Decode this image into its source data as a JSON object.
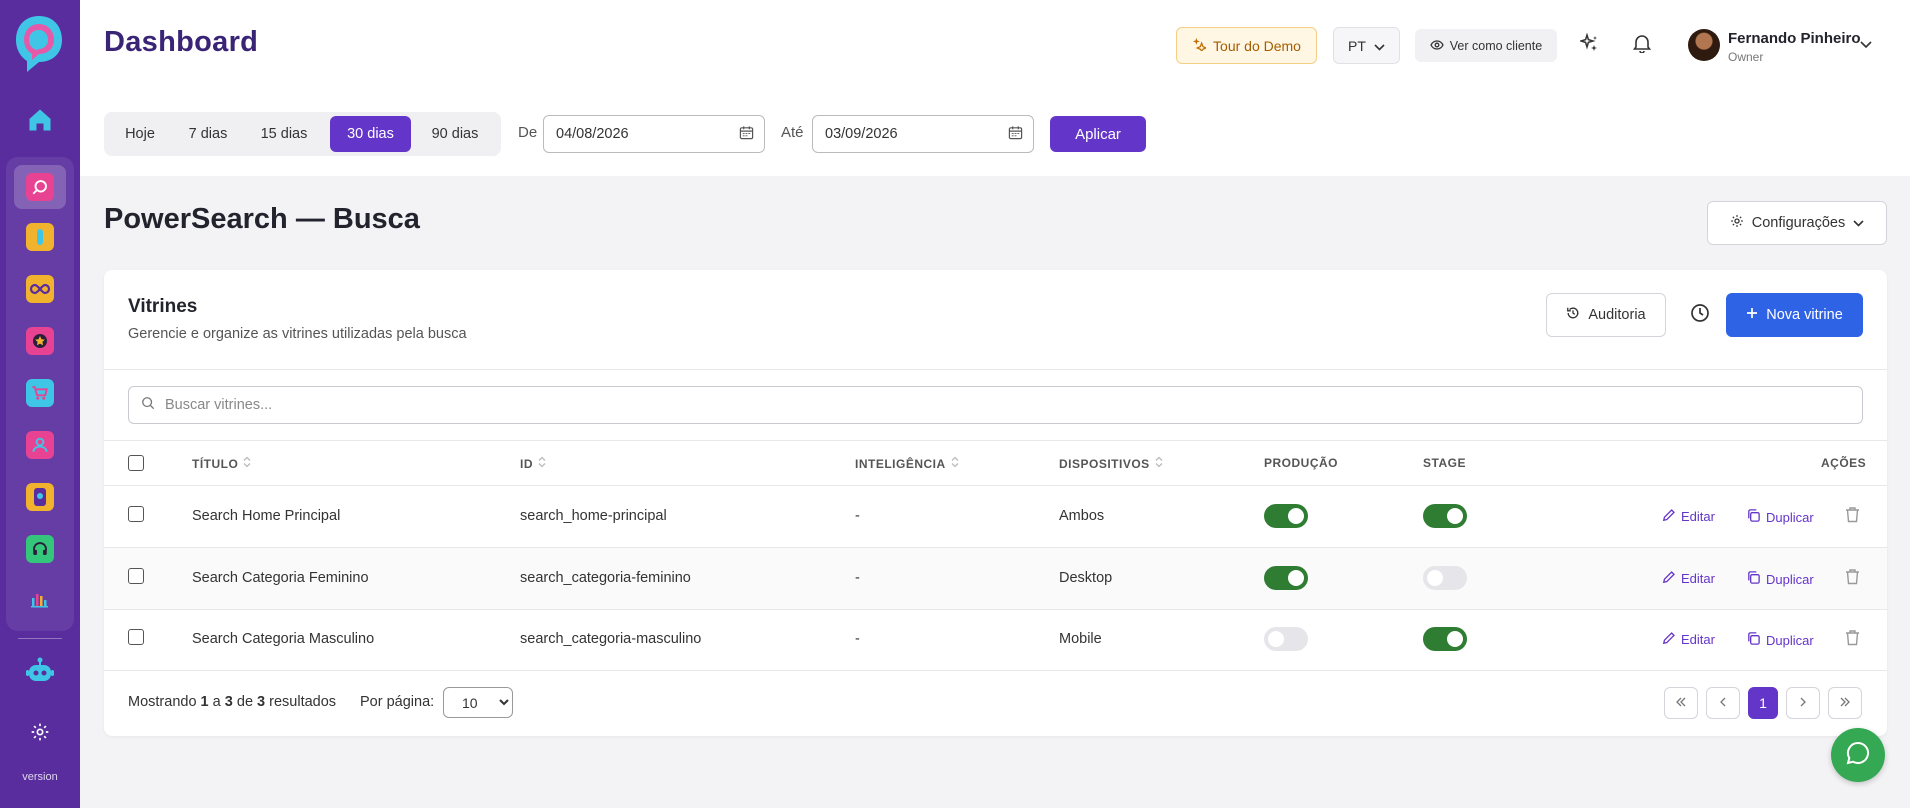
{
  "app": {
    "page_title": "Dashboard",
    "version_label": "version"
  },
  "header": {
    "tour_label": "Tour do Demo",
    "language": "PT",
    "view_as_label": "Ver como cliente",
    "user": {
      "name": "Fernando Pinheiro",
      "role": "Owner"
    }
  },
  "date_filter": {
    "ranges": [
      "Hoje",
      "7 dias",
      "15 dias",
      "30 dias",
      "90 dias"
    ],
    "active_range": "30 dias",
    "from_label": "De",
    "from_value": "04/08/2026",
    "to_label": "Até",
    "to_value": "03/09/2026",
    "apply_label": "Aplicar"
  },
  "section": {
    "title": "PowerSearch — Busca",
    "settings_label": "Configurações"
  },
  "card": {
    "title": "Vitrines",
    "subtitle": "Gerencie e organize as vitrines utilizadas pela busca",
    "audit_label": "Auditoria",
    "new_label": "Nova vitrine",
    "search_placeholder": "Buscar vitrines..."
  },
  "table": {
    "headers": {
      "title": "TÍTULO",
      "id": "ID",
      "intelligence": "INTELIGÊNCIA",
      "devices": "DISPOSITIVOS",
      "production": "PRODUÇÃO",
      "stage": "STAGE",
      "actions": "AÇÕES"
    },
    "edit_label": "Editar",
    "duplicate_label": "Duplicar",
    "rows": [
      {
        "title": "Search Home Principal",
        "id": "search_home-principal",
        "intelligence": "-",
        "devices": "Ambos",
        "production": true,
        "stage": true
      },
      {
        "title": "Search Categoria Feminino",
        "id": "search_categoria-feminino",
        "intelligence": "-",
        "devices": "Desktop",
        "production": true,
        "stage": false
      },
      {
        "title": "Search Categoria Masculino",
        "id": "search_categoria-masculino",
        "intelligence": "-",
        "devices": "Mobile",
        "production": false,
        "stage": true
      }
    ]
  },
  "pagination": {
    "showing_prefix": "Mostrando",
    "from": "1",
    "connector_a": "a",
    "to": "3",
    "connector_de": "de",
    "total": "3",
    "suffix": "resultados",
    "per_page_label": "Por página:",
    "per_page_value": "10",
    "current_page": "1"
  },
  "colors": {
    "sidebar": "#5a2d9e",
    "primary": "#6435c9",
    "blue": "#2f63e6",
    "toggle_on": "#2e7d32",
    "chat": "#34a853"
  }
}
